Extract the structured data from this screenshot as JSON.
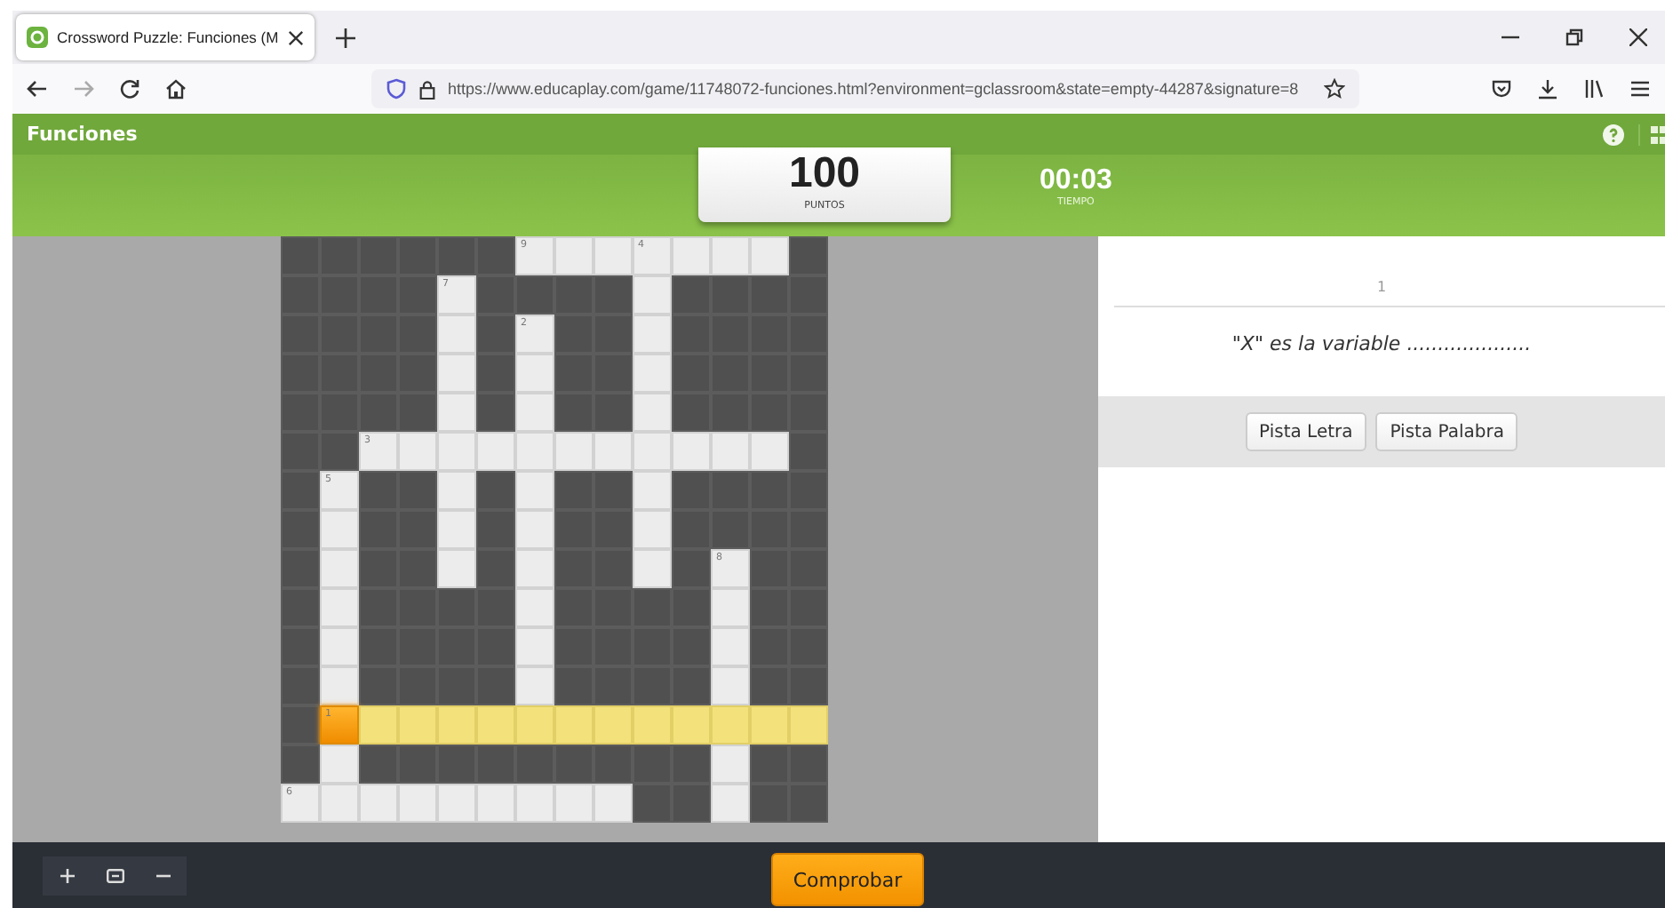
{
  "browser": {
    "tab_title": "Crossword Puzzle: Funciones (M",
    "url": "https://www.educaplay.com/game/11748072-funciones.html?environment=gclassroom&state=empty-44287&signature=8"
  },
  "header": {
    "title": "Funciones"
  },
  "score": {
    "value": "100",
    "label": "PUNTOS"
  },
  "timer": {
    "value": "00:03",
    "label": "TIEMPO"
  },
  "grid": {
    "rows": [
      [
        {
          "kind": "block"
        },
        {
          "kind": "block"
        },
        {
          "kind": "block"
        },
        {
          "kind": "block"
        },
        {
          "kind": "block"
        },
        {
          "kind": "block"
        },
        {
          "kind": "open",
          "number": "9"
        },
        {
          "kind": "open"
        },
        {
          "kind": "open"
        },
        {
          "kind": "open",
          "number": "4"
        },
        {
          "kind": "open"
        },
        {
          "kind": "open"
        },
        {
          "kind": "open"
        },
        {
          "kind": "block"
        }
      ],
      [
        {
          "kind": "block"
        },
        {
          "kind": "block"
        },
        {
          "kind": "block"
        },
        {
          "kind": "block"
        },
        {
          "kind": "open",
          "number": "7"
        },
        {
          "kind": "block"
        },
        {
          "kind": "block"
        },
        {
          "kind": "block"
        },
        {
          "kind": "block"
        },
        {
          "kind": "open"
        },
        {
          "kind": "block"
        },
        {
          "kind": "block"
        },
        {
          "kind": "block"
        },
        {
          "kind": "block"
        }
      ],
      [
        {
          "kind": "block"
        },
        {
          "kind": "block"
        },
        {
          "kind": "block"
        },
        {
          "kind": "block"
        },
        {
          "kind": "open"
        },
        {
          "kind": "block"
        },
        {
          "kind": "open",
          "number": "2"
        },
        {
          "kind": "block"
        },
        {
          "kind": "block"
        },
        {
          "kind": "open"
        },
        {
          "kind": "block"
        },
        {
          "kind": "block"
        },
        {
          "kind": "block"
        },
        {
          "kind": "block"
        }
      ],
      [
        {
          "kind": "block"
        },
        {
          "kind": "block"
        },
        {
          "kind": "block"
        },
        {
          "kind": "block"
        },
        {
          "kind": "open"
        },
        {
          "kind": "block"
        },
        {
          "kind": "open"
        },
        {
          "kind": "block"
        },
        {
          "kind": "block"
        },
        {
          "kind": "open"
        },
        {
          "kind": "block"
        },
        {
          "kind": "block"
        },
        {
          "kind": "block"
        },
        {
          "kind": "block"
        }
      ],
      [
        {
          "kind": "block"
        },
        {
          "kind": "block"
        },
        {
          "kind": "block"
        },
        {
          "kind": "block"
        },
        {
          "kind": "open"
        },
        {
          "kind": "block"
        },
        {
          "kind": "open"
        },
        {
          "kind": "block"
        },
        {
          "kind": "block"
        },
        {
          "kind": "open"
        },
        {
          "kind": "block"
        },
        {
          "kind": "block"
        },
        {
          "kind": "block"
        },
        {
          "kind": "block"
        }
      ],
      [
        {
          "kind": "block"
        },
        {
          "kind": "block"
        },
        {
          "kind": "open",
          "number": "3"
        },
        {
          "kind": "open"
        },
        {
          "kind": "open"
        },
        {
          "kind": "open"
        },
        {
          "kind": "open"
        },
        {
          "kind": "open"
        },
        {
          "kind": "open"
        },
        {
          "kind": "open"
        },
        {
          "kind": "open"
        },
        {
          "kind": "open"
        },
        {
          "kind": "open"
        },
        {
          "kind": "block"
        }
      ],
      [
        {
          "kind": "block"
        },
        {
          "kind": "open",
          "number": "5"
        },
        {
          "kind": "block"
        },
        {
          "kind": "block"
        },
        {
          "kind": "open"
        },
        {
          "kind": "block"
        },
        {
          "kind": "open"
        },
        {
          "kind": "block"
        },
        {
          "kind": "block"
        },
        {
          "kind": "open"
        },
        {
          "kind": "block"
        },
        {
          "kind": "block"
        },
        {
          "kind": "block"
        },
        {
          "kind": "block"
        }
      ],
      [
        {
          "kind": "block"
        },
        {
          "kind": "open"
        },
        {
          "kind": "block"
        },
        {
          "kind": "block"
        },
        {
          "kind": "open"
        },
        {
          "kind": "block"
        },
        {
          "kind": "open"
        },
        {
          "kind": "block"
        },
        {
          "kind": "block"
        },
        {
          "kind": "open"
        },
        {
          "kind": "block"
        },
        {
          "kind": "block"
        },
        {
          "kind": "block"
        },
        {
          "kind": "block"
        }
      ],
      [
        {
          "kind": "block"
        },
        {
          "kind": "open"
        },
        {
          "kind": "block"
        },
        {
          "kind": "block"
        },
        {
          "kind": "open"
        },
        {
          "kind": "block"
        },
        {
          "kind": "open"
        },
        {
          "kind": "block"
        },
        {
          "kind": "block"
        },
        {
          "kind": "open"
        },
        {
          "kind": "block"
        },
        {
          "kind": "open",
          "number": "8"
        },
        {
          "kind": "block"
        },
        {
          "kind": "block"
        }
      ],
      [
        {
          "kind": "block"
        },
        {
          "kind": "open"
        },
        {
          "kind": "block"
        },
        {
          "kind": "block"
        },
        {
          "kind": "block"
        },
        {
          "kind": "block"
        },
        {
          "kind": "open"
        },
        {
          "kind": "block"
        },
        {
          "kind": "block"
        },
        {
          "kind": "block"
        },
        {
          "kind": "block"
        },
        {
          "kind": "open"
        },
        {
          "kind": "block"
        },
        {
          "kind": "block"
        }
      ],
      [
        {
          "kind": "block"
        },
        {
          "kind": "open"
        },
        {
          "kind": "block"
        },
        {
          "kind": "block"
        },
        {
          "kind": "block"
        },
        {
          "kind": "block"
        },
        {
          "kind": "open"
        },
        {
          "kind": "block"
        },
        {
          "kind": "block"
        },
        {
          "kind": "block"
        },
        {
          "kind": "block"
        },
        {
          "kind": "open"
        },
        {
          "kind": "block"
        },
        {
          "kind": "block"
        }
      ],
      [
        {
          "kind": "block"
        },
        {
          "kind": "open"
        },
        {
          "kind": "block"
        },
        {
          "kind": "block"
        },
        {
          "kind": "block"
        },
        {
          "kind": "block"
        },
        {
          "kind": "open"
        },
        {
          "kind": "block"
        },
        {
          "kind": "block"
        },
        {
          "kind": "block"
        },
        {
          "kind": "block"
        },
        {
          "kind": "open"
        },
        {
          "kind": "block"
        },
        {
          "kind": "block"
        }
      ],
      [
        {
          "kind": "block"
        },
        {
          "kind": "active",
          "number": "1"
        },
        {
          "kind": "highlighted"
        },
        {
          "kind": "highlighted"
        },
        {
          "kind": "highlighted"
        },
        {
          "kind": "highlighted"
        },
        {
          "kind": "highlighted"
        },
        {
          "kind": "highlighted"
        },
        {
          "kind": "highlighted"
        },
        {
          "kind": "highlighted"
        },
        {
          "kind": "highlighted"
        },
        {
          "kind": "highlighted"
        },
        {
          "kind": "highlighted"
        },
        {
          "kind": "highlighted"
        }
      ],
      [
        {
          "kind": "block"
        },
        {
          "kind": "open"
        },
        {
          "kind": "block"
        },
        {
          "kind": "block"
        },
        {
          "kind": "block"
        },
        {
          "kind": "block"
        },
        {
          "kind": "block"
        },
        {
          "kind": "block"
        },
        {
          "kind": "block"
        },
        {
          "kind": "block"
        },
        {
          "kind": "block"
        },
        {
          "kind": "open"
        },
        {
          "kind": "block"
        },
        {
          "kind": "block"
        }
      ],
      [
        {
          "kind": "open",
          "number": "6"
        },
        {
          "kind": "open"
        },
        {
          "kind": "open"
        },
        {
          "kind": "open"
        },
        {
          "kind": "open"
        },
        {
          "kind": "open"
        },
        {
          "kind": "open"
        },
        {
          "kind": "open"
        },
        {
          "kind": "open"
        },
        {
          "kind": "block"
        },
        {
          "kind": "block"
        },
        {
          "kind": "open"
        },
        {
          "kind": "block"
        },
        {
          "kind": "block"
        }
      ]
    ]
  },
  "clue": {
    "number": "1",
    "text": "\"X\" es la variable ...................."
  },
  "hint_buttons": [
    "Pista Letra",
    "Pista Palabra"
  ],
  "check_button": "Comprobar"
}
